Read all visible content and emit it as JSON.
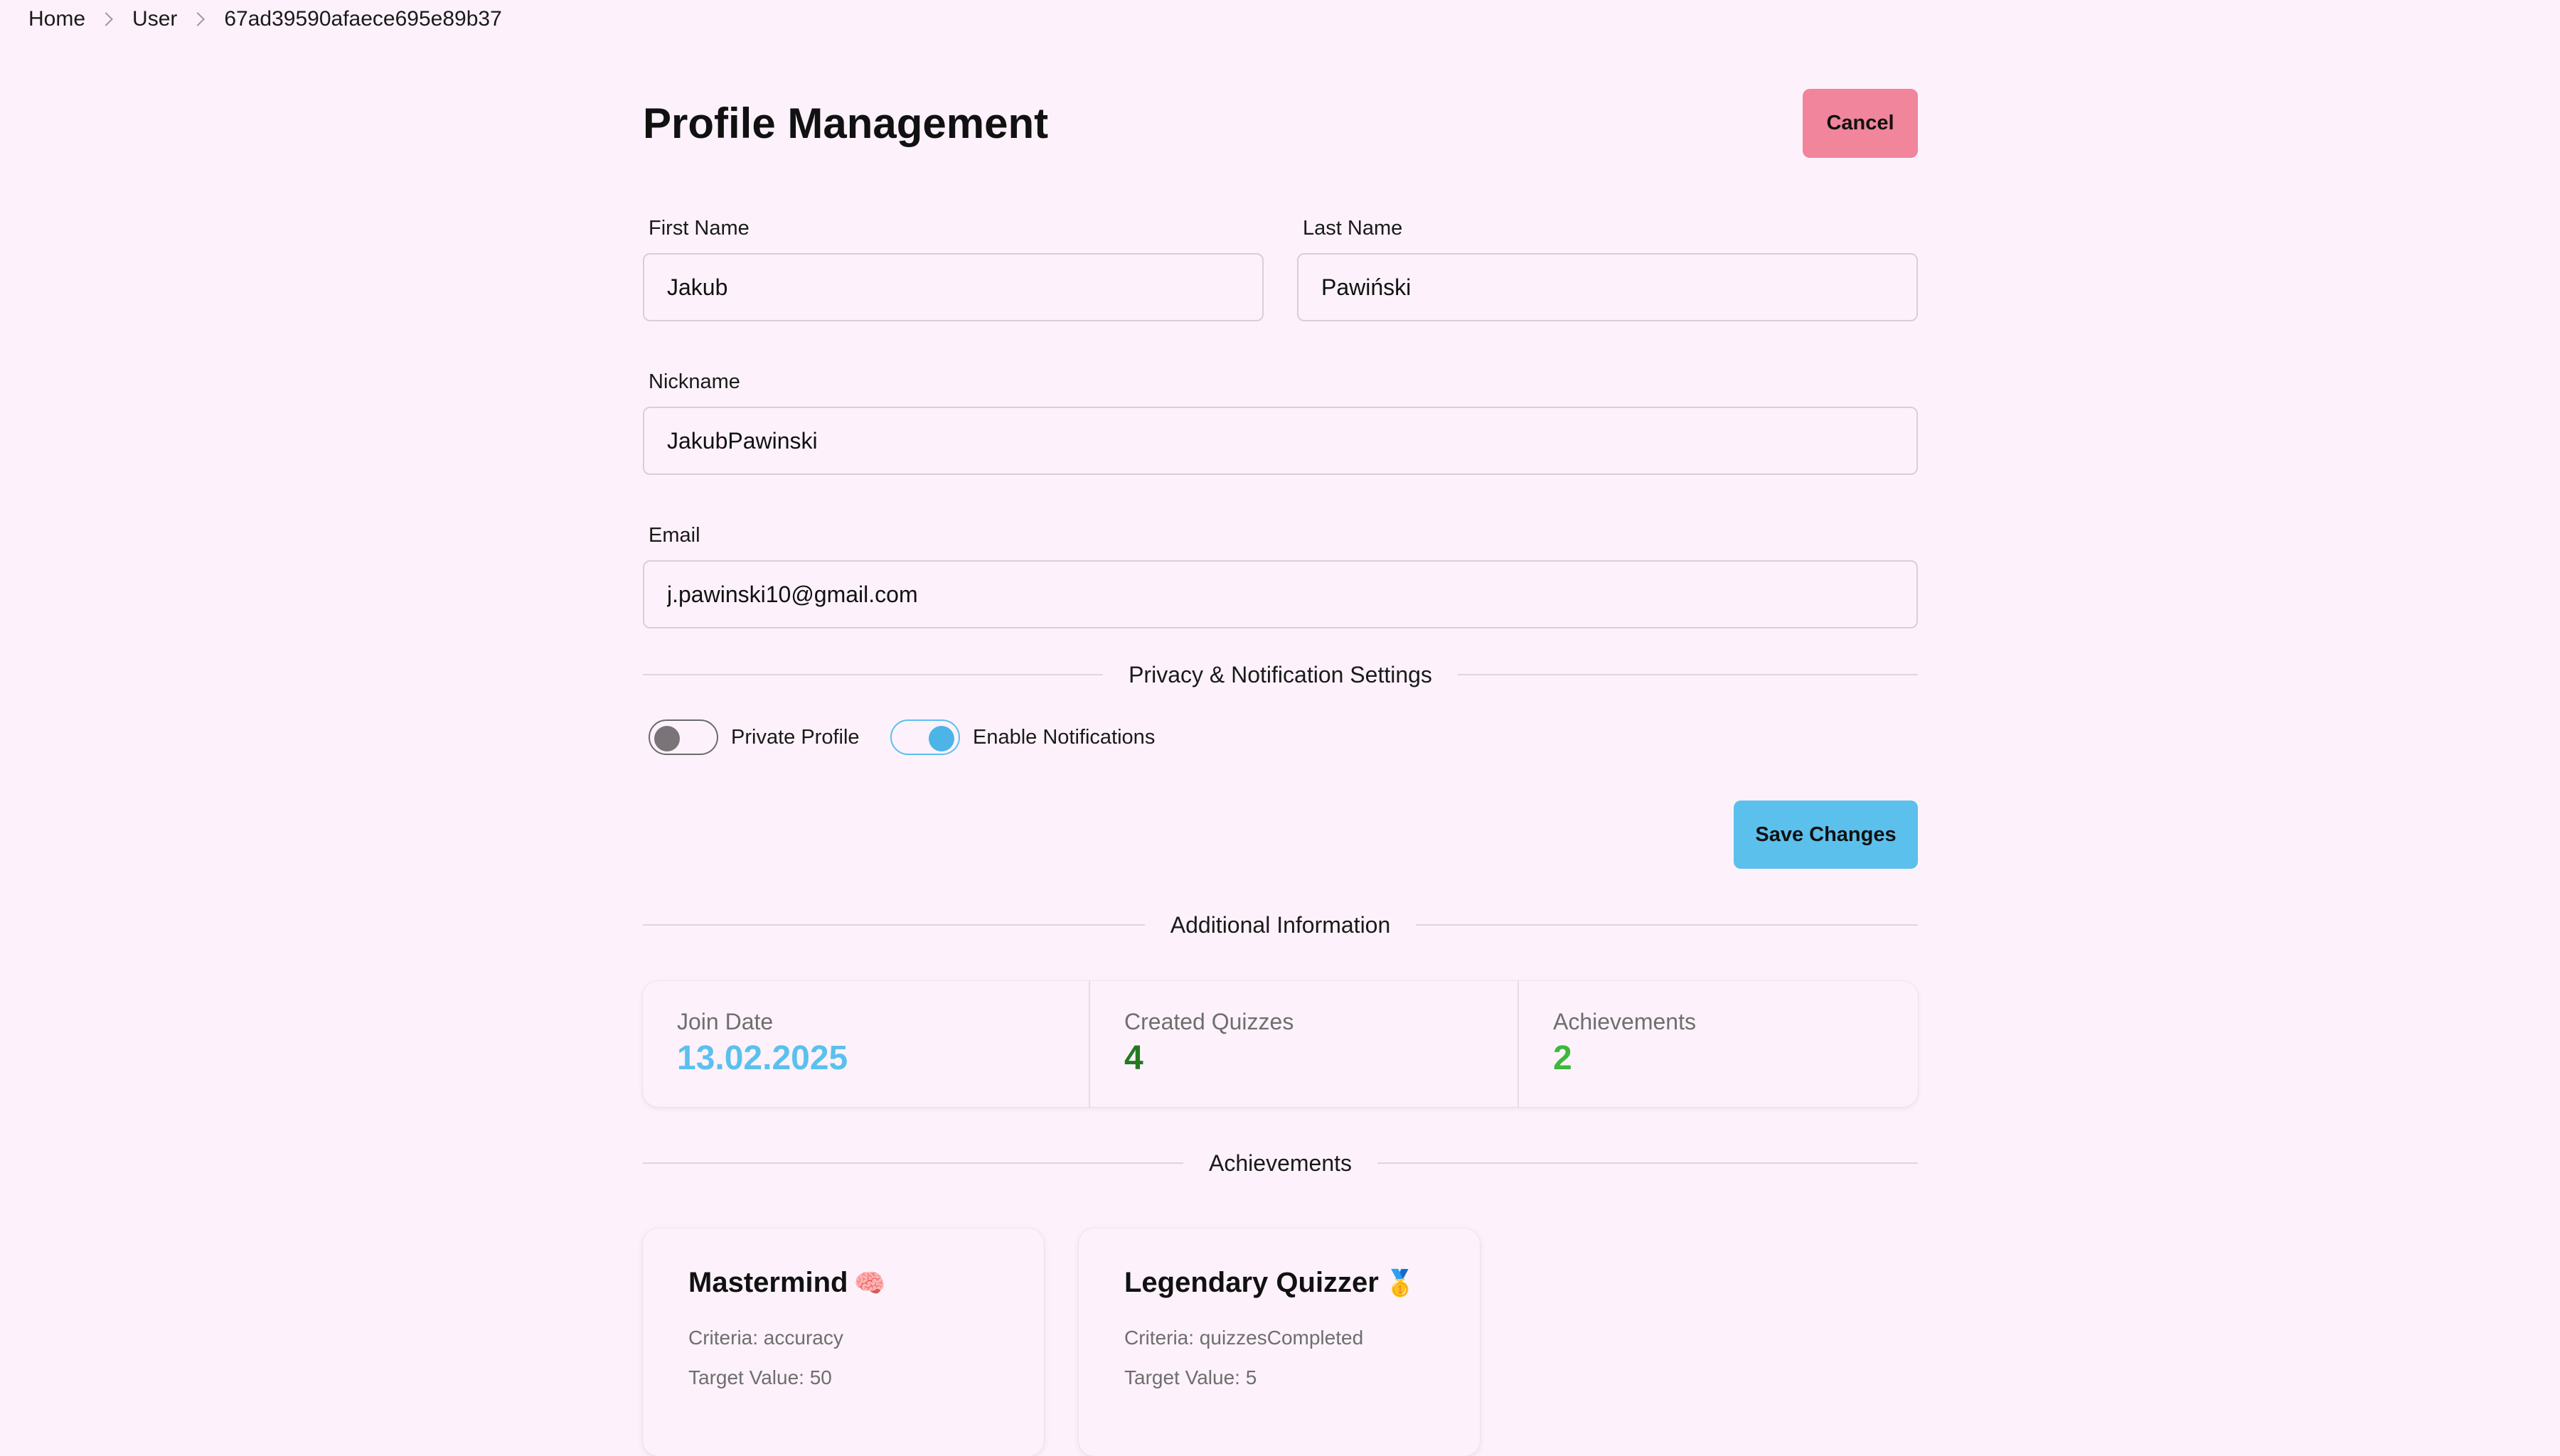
{
  "breadcrumb": {
    "items": [
      "Home",
      "User",
      "67ad39590afaece695e89b37"
    ]
  },
  "header": {
    "title": "Profile Management",
    "cancel_label": "Cancel"
  },
  "form": {
    "first_name": {
      "label": "First Name",
      "value": "Jakub"
    },
    "last_name": {
      "label": "Last Name",
      "value": "Pawiński"
    },
    "nickname": {
      "label": "Nickname",
      "value": "JakubPawinski"
    },
    "email": {
      "label": "Email",
      "value": "j.pawinski10@gmail.com"
    }
  },
  "settings": {
    "section_title": "Privacy & Notification Settings",
    "private_profile": {
      "label": "Private Profile",
      "enabled": false
    },
    "notifications": {
      "label": "Enable Notifications",
      "enabled": true
    },
    "save_label": "Save Changes"
  },
  "additional": {
    "section_title": "Additional Information",
    "stats": [
      {
        "label": "Join Date",
        "value": "13.02.2025",
        "color": "#5bc0ec"
      },
      {
        "label": "Created Quizzes",
        "value": "4",
        "color": "#237a1e"
      },
      {
        "label": "Achievements",
        "value": "2",
        "color": "#3db83a"
      }
    ]
  },
  "achievements": {
    "section_title": "Achievements",
    "items": [
      {
        "title": "Mastermind",
        "emoji": "🧠",
        "criteria": "Criteria: accuracy",
        "target": "Target Value: 50"
      },
      {
        "title": "Legendary Quizzer",
        "emoji": "🥇",
        "criteria": "Criteria: quizzesCompleted",
        "target": "Target Value: 5"
      }
    ]
  },
  "colors": {
    "background": "#fdf2fb",
    "cancel": "#f0859b",
    "primary": "#5bc0ec"
  }
}
